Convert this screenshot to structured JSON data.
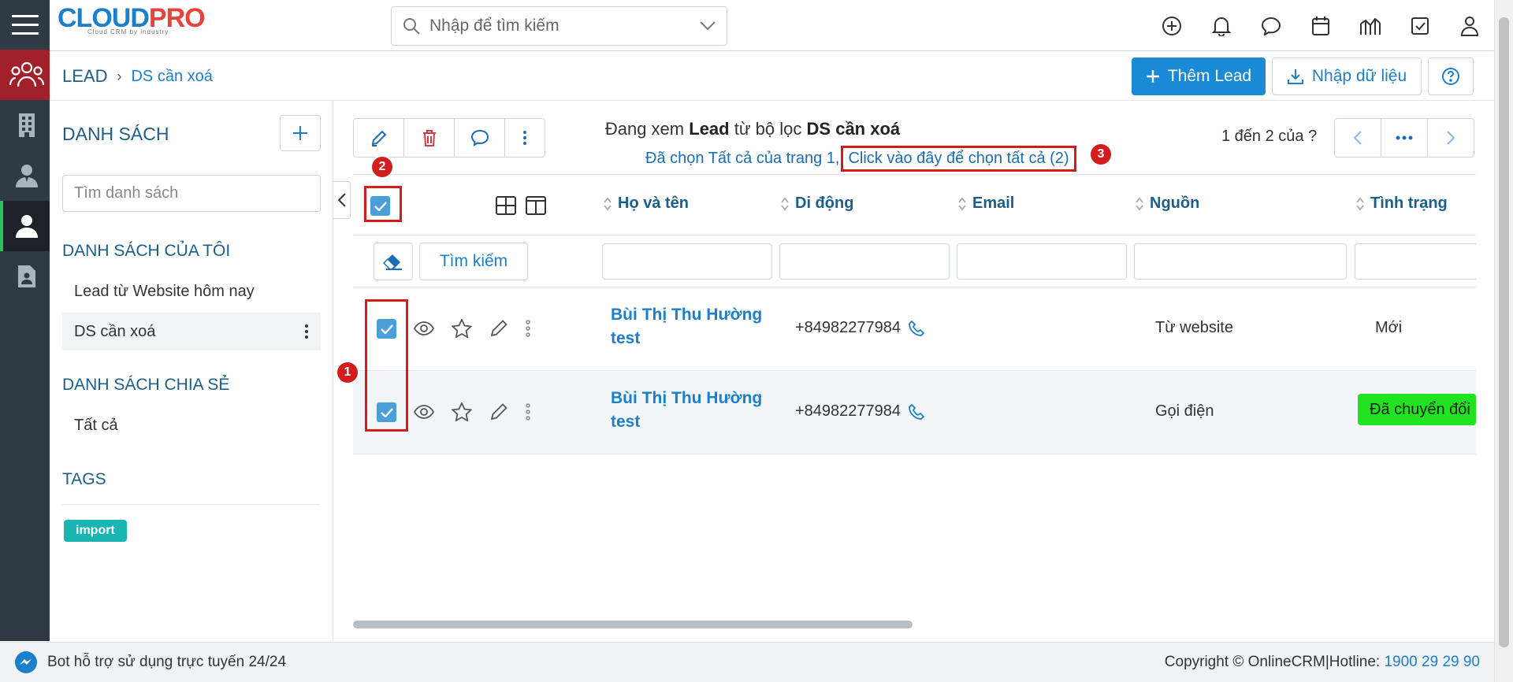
{
  "app": {
    "logo_text_a": "CLOUD",
    "logo_text_b": "PRO",
    "logo_tagline": "Cloud CRM by industry",
    "brand_color": "#1b7fcc",
    "accent_color": "#e7433c"
  },
  "search": {
    "placeholder": "Nhập để tìm kiếm"
  },
  "rail": {
    "items": [
      {
        "icon": "users-group-icon",
        "active": true
      },
      {
        "icon": "building-icon",
        "active": false
      },
      {
        "icon": "contact-person-icon",
        "active": false
      },
      {
        "icon": "lead-person-icon",
        "active": true
      },
      {
        "icon": "document-person-icon",
        "active": false
      }
    ]
  },
  "top_icons": [
    "add-circle-icon",
    "bell-icon",
    "chat-bubble-icon",
    "calendar-icon",
    "chart-icon",
    "task-check-icon",
    "user-icon"
  ],
  "breadcrumb": {
    "root": "LEAD",
    "leaf": "DS cần xoá"
  },
  "actions": {
    "add_label": "Thêm Lead",
    "import_label": "Nhập dữ liệu"
  },
  "listpanel": {
    "title": "DANH SÁCH",
    "search_placeholder": "Tìm danh sách",
    "my_lists_title": "DANH SÁCH CỦA TÔI",
    "my_lists": [
      "Lead từ Website hôm nay",
      "DS cần xoá"
    ],
    "shared_title": "DANH SÁCH CHIA SẺ",
    "shared": [
      "Tất cả"
    ],
    "tags_title": "TAGS",
    "tags": [
      "import"
    ]
  },
  "main": {
    "viewing_prefix": "Đang xem",
    "viewing_module": "Lead",
    "viewing_mid": "từ bộ lọc",
    "viewing_filter": "DS cần xoá",
    "selected_note": "Đã chọn Tất cả của trang 1,",
    "select_all_link": "Click vào đây để chọn tất cả (2)",
    "pager_text": "1 đến 2 của",
    "pager_question": "?",
    "search_button": "Tìm kiếm",
    "columns": [
      "Họ và tên",
      "Di động",
      "Email",
      "Nguồn",
      "Tình trạng"
    ],
    "rows": [
      {
        "name_line1": "Bùi Thị Thu Hường",
        "name_line2": "test",
        "phone": "+84982277984",
        "email": "",
        "source": "Từ website",
        "status": "Mới",
        "status_badge": false
      },
      {
        "name_line1": "Bùi Thị Thu Hường",
        "name_line2": "test",
        "phone": "+84982277984",
        "email": "",
        "source": "Gọi điện",
        "status": "Đã chuyển đổi",
        "status_badge": true
      }
    ],
    "markers": [
      "1",
      "2",
      "3"
    ]
  },
  "footer": {
    "bot_text": "Bot hỗ trợ sử dụng trực tuyến 24/24",
    "copyright": "Copyright © OnlineCRM|Hotline:",
    "hotline": "1900 29 29 90"
  },
  "colors": {
    "primary_button": "#1b8ad6",
    "highlight_red": "#d41c1c",
    "converted_green": "#21e31f",
    "checkbox": "#4b9fd8"
  }
}
